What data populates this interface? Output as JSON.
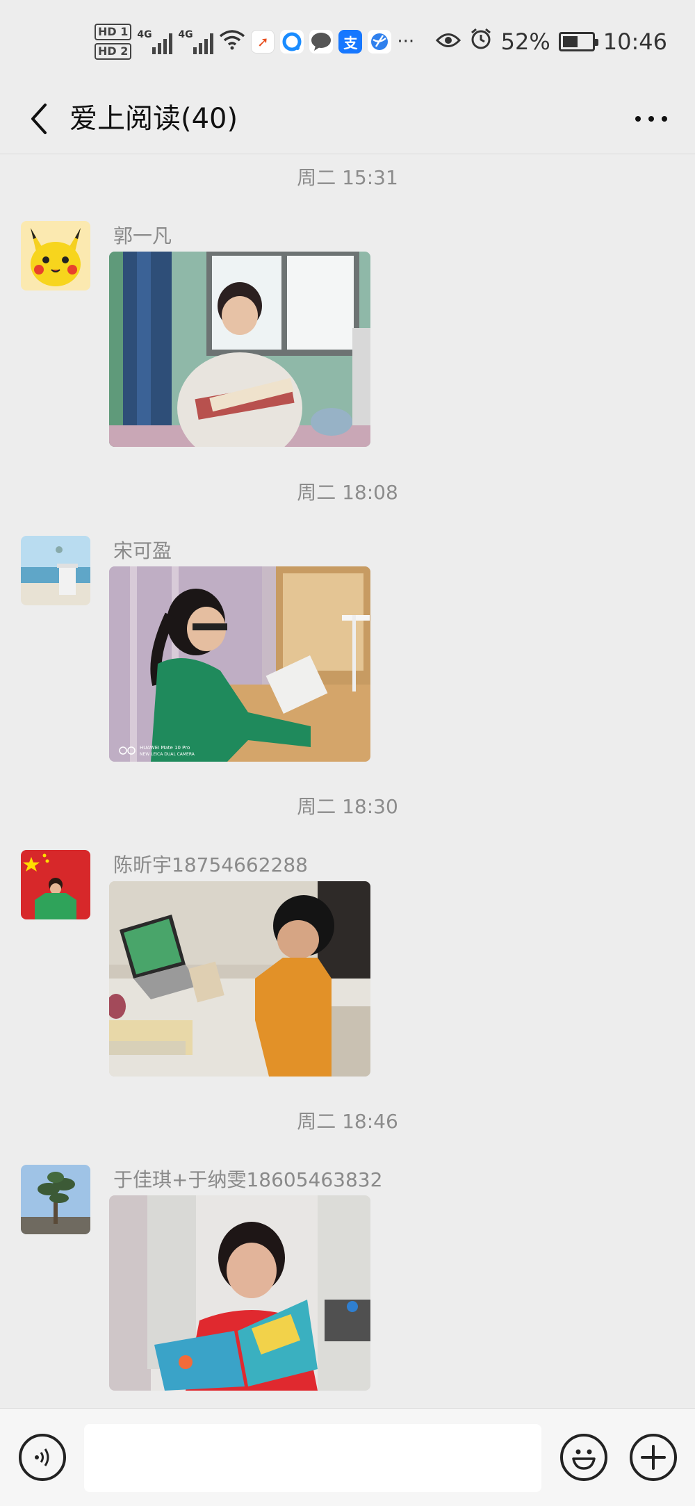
{
  "status_bar": {
    "hd1": "HD 1",
    "hd2": "HD 2",
    "net1": "4G",
    "net2": "4G",
    "battery_pct": "52%",
    "battery_level": 0.52,
    "time": "10:46",
    "more_icons": "···"
  },
  "header": {
    "title": "爱上阅读(40)"
  },
  "messages": [
    {
      "timestamp": "周二 15:31",
      "sender": "郭一凡",
      "avatar_icon": "pikachu-avatar",
      "photo_icon": "girl-reading-photo"
    },
    {
      "timestamp": "周二 18:08",
      "sender": "宋可盈",
      "avatar_icon": "beach-avatar",
      "photo_icon": "girl-reading-desk-photo",
      "photo_watermark": [
        "HUAWEI Mate 10 Pro",
        "NEW LEICA DUAL CAMERA"
      ]
    },
    {
      "timestamp": "周二 18:30",
      "sender": "陈昕宇18754662288",
      "avatar_icon": "flag-boy-avatar",
      "photo_icon": "boy-reading-laptop-photo"
    },
    {
      "timestamp": "周二 18:46",
      "sender": "于佳琪+于纳雯18605463832",
      "avatar_icon": "tree-avatar",
      "photo_icon": "girl-reading-book-photo"
    }
  ],
  "input_bar": {
    "placeholder": ""
  },
  "colors": {
    "background": "#ededed",
    "secondary_text": "#8c8c8c"
  }
}
